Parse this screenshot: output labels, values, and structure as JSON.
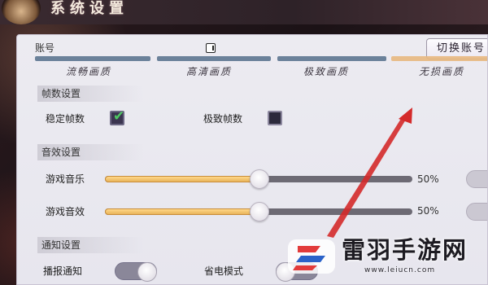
{
  "window": {
    "title": "系统设置"
  },
  "account": {
    "label": "账号",
    "switch_button": "切换账号"
  },
  "quality_presets": [
    {
      "label": "流畅画质",
      "active": false
    },
    {
      "label": "高清画质",
      "active": false
    },
    {
      "label": "极致画质",
      "active": false
    },
    {
      "label": "无损画质",
      "active": true
    }
  ],
  "frame_rate": {
    "header": "帧数设置",
    "options": [
      {
        "label": "稳定帧数",
        "checked": true
      },
      {
        "label": "极致帧数",
        "checked": false
      }
    ]
  },
  "audio": {
    "header": "音效设置",
    "sliders": [
      {
        "label": "游戏音乐",
        "value": 50,
        "value_text": "50%"
      },
      {
        "label": "游戏音效",
        "value": 50,
        "value_text": "50%"
      }
    ]
  },
  "notifications": {
    "header": "通知设置",
    "toggles": [
      {
        "label": "播报通知",
        "on": false
      },
      {
        "label": "省电模式",
        "on": false
      }
    ]
  },
  "watermark": {
    "brand": "雷羽手游网",
    "url": "www.leiucn.com"
  },
  "colors": {
    "accent_gold": "#e9b45a",
    "check_green": "#4fc862",
    "arrow_red": "#d42a2a",
    "panel_bg": "#ecebf1"
  }
}
